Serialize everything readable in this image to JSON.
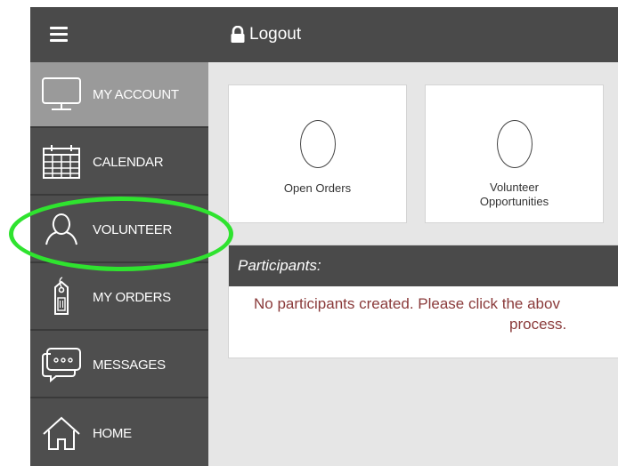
{
  "topbar": {
    "logout_label": "Logout"
  },
  "sidebar": {
    "items": [
      {
        "label": "MY ACCOUNT",
        "icon": "monitor-icon",
        "active": true
      },
      {
        "label": "CALENDAR",
        "icon": "calendar-icon",
        "active": false
      },
      {
        "label": "VOLUNTEER",
        "icon": "person-icon",
        "active": false
      },
      {
        "label": "MY ORDERS",
        "icon": "tag-icon",
        "active": false
      },
      {
        "label": "MESSAGES",
        "icon": "chat-icon",
        "active": false
      },
      {
        "label": "HOME",
        "icon": "home-icon",
        "active": false
      }
    ]
  },
  "cards": [
    {
      "value": "0",
      "label": "Open Orders"
    },
    {
      "value": "0",
      "label_line1": "Volunteer",
      "label_line2": "Opportunities"
    }
  ],
  "participants": {
    "header": "Participants:",
    "message_line1": "No participants created. Please click the abov",
    "message_line2": "process."
  },
  "colors": {
    "topbar": "#4a4a4a",
    "sidebar": "#4e4e4e",
    "sidebar_active": "#9a9a9a",
    "content_bg": "#e6e6e6",
    "message_text": "#8a3a3a",
    "highlight": "#2fe32f"
  }
}
